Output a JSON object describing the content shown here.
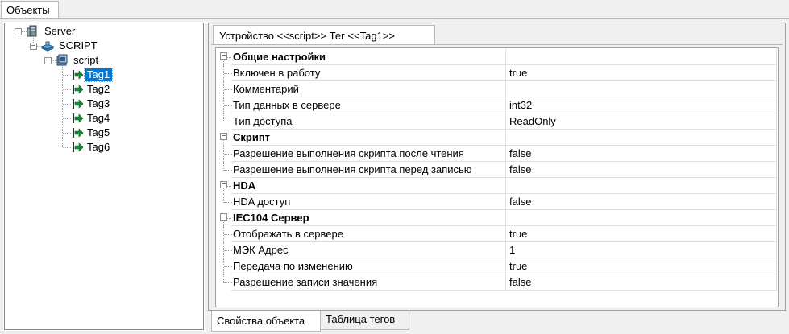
{
  "top_tab": {
    "label": "Объекты"
  },
  "tree": {
    "server": "Server",
    "device": "SCRIPT",
    "group": "script",
    "tags": [
      "Tag1",
      "Tag2",
      "Tag3",
      "Tag4",
      "Tag5",
      "Tag6"
    ],
    "selected": "Tag1"
  },
  "doc_tab": {
    "label": "Устройство <<script>> Тег  <<Tag1>>"
  },
  "properties": [
    {
      "type": "category",
      "name": "Общие настройки",
      "value": ""
    },
    {
      "type": "prop",
      "name": "Включен в работу",
      "value": "true"
    },
    {
      "type": "prop",
      "name": "Комментарий",
      "value": ""
    },
    {
      "type": "prop",
      "name": "Тип данных в сервере",
      "value": "int32"
    },
    {
      "type": "prop",
      "name": "Тип доступа",
      "value": "ReadOnly"
    },
    {
      "type": "category",
      "name": "Скрипт",
      "value": ""
    },
    {
      "type": "prop",
      "name": "Разрешение выполнения скрипта после чтения",
      "value": "false"
    },
    {
      "type": "prop",
      "name": "Разрешение выполнения скрипта перед записью",
      "value": "false"
    },
    {
      "type": "category",
      "name": "HDA",
      "value": ""
    },
    {
      "type": "prop",
      "name": "HDA доступ",
      "value": "false"
    },
    {
      "type": "category",
      "name": "IEC104 Сервер",
      "value": ""
    },
    {
      "type": "prop",
      "name": "Отображать в сервере",
      "value": "true"
    },
    {
      "type": "prop",
      "name": "МЭК Адрес",
      "value": "1"
    },
    {
      "type": "prop",
      "name": "Передача по изменению",
      "value": "true"
    },
    {
      "type": "prop",
      "name": "Разрешение записи значения",
      "value": "false"
    }
  ],
  "bottom_tabs": {
    "active": "Свойства объекта",
    "inactive": "Таблица тегов"
  },
  "icons": {
    "server": "server-icon",
    "device": "device-icon",
    "group": "folder-icon",
    "tag": "tag-arrow-icon"
  },
  "colors": {
    "selection": "#0078d7",
    "tag_arrow": "#1a8a3a"
  }
}
